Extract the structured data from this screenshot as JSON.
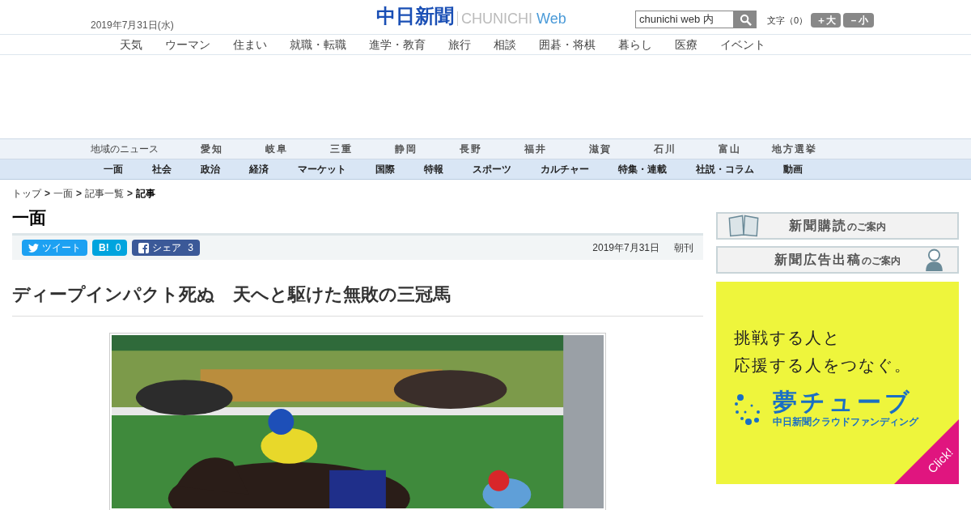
{
  "header": {
    "date": "2019年7月31日(水)",
    "logo_main": "中日新聞",
    "logo_sub": "CHUNICHI",
    "logo_web": "Web",
    "search": {
      "value": "chunichi web 内"
    },
    "font_size": {
      "label": "文字（0）",
      "larger": "＋大",
      "smaller": "－小"
    }
  },
  "top_nav": [
    "天気",
    "ウーマン",
    "住まい",
    "就職・転職",
    "進学・教育",
    "旅行",
    "相談",
    "囲碁・将棋",
    "暮らし",
    "医療",
    "イベント"
  ],
  "region_nav": {
    "label": "地域のニュース",
    "items": [
      "愛知",
      "岐阜",
      "三重",
      "静岡",
      "長野",
      "福井",
      "滋賀",
      "石川",
      "富山",
      "地方選挙"
    ]
  },
  "category_nav": [
    "一面",
    "社会",
    "政治",
    "経済",
    "マーケット",
    "国際",
    "特報",
    "スポーツ",
    "カルチャー",
    "特集・連載",
    "社説・コラム",
    "動画"
  ],
  "breadcrumb_separator": ">",
  "breadcrumb": [
    {
      "label": "トップ",
      "current": false
    },
    {
      "label": "一面",
      "current": false
    },
    {
      "label": "記事一覧",
      "current": false
    },
    {
      "label": "記事",
      "current": true
    }
  ],
  "section_title": "一面",
  "share": [
    {
      "kind": "twitter",
      "label": "ツイート"
    },
    {
      "kind": "hatena",
      "label": "B!",
      "count": "0"
    },
    {
      "kind": "facebook",
      "label": "シェア",
      "count": "3"
    }
  ],
  "article": {
    "date": "2019年7月31日",
    "edition": "朝刊",
    "headline": "ディープインパクト死ぬ　天へと駆けた無敗の三冠馬"
  },
  "sidebar": {
    "banners": [
      {
        "kind": "book",
        "title": "新聞購読",
        "suffix": "のご案内"
      },
      {
        "kind": "person",
        "title": "新聞広告出稿",
        "suffix": "のご案内"
      }
    ],
    "ad": {
      "line1": "挑戦する人と",
      "line2": "応援する人をつなぐ。",
      "brand": "夢チューブ",
      "brand_sub": "中日新聞クラウドファンディング",
      "corner": "Click!"
    }
  }
}
